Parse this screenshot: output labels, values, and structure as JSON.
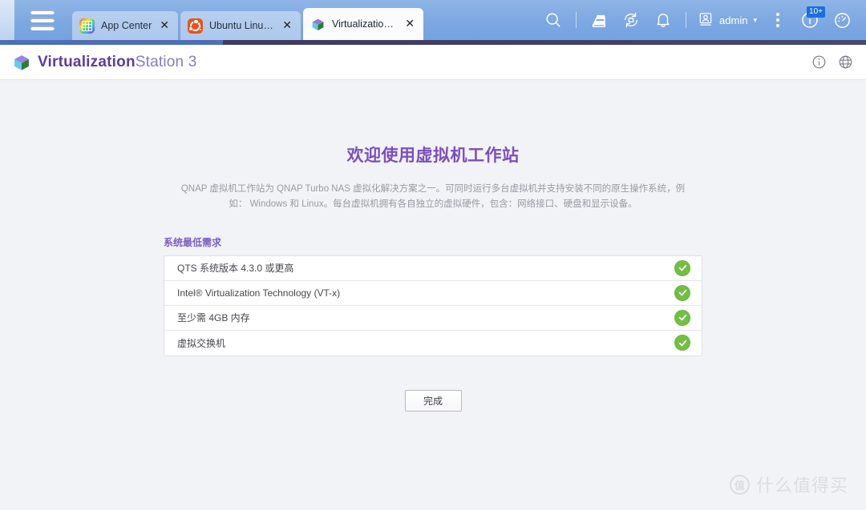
{
  "desktop": {
    "menu_icon": "hamburger-menu-icon",
    "tabs": [
      {
        "label": "App Center",
        "icon": "app-center-icon",
        "close": "✕",
        "active": false
      },
      {
        "label": "Ubuntu Linux ...",
        "icon": "ubuntu-icon",
        "close": "✕",
        "active": false
      },
      {
        "label": "Virtualization ...",
        "icon": "virtualization-cube-icon",
        "close": "✕",
        "active": true
      }
    ],
    "system_icons": [
      "search-icon",
      "background-tasks-icon",
      "sync-icon",
      "notification-bell-icon"
    ],
    "user": {
      "name": "admin",
      "caret": "▾",
      "icon": "user-avatar-icon"
    },
    "more_icon": "more-options-icon",
    "info_icon": "info-icon",
    "info_badge": "10+",
    "dashboard_icon": "dashboard-gauge-icon"
  },
  "app": {
    "title_bold": "Virtualization",
    "title_normal": "Station 3",
    "logo_icon": "virtualization-cube-icon",
    "header_icons": [
      "info-icon",
      "language-globe-icon"
    ]
  },
  "main": {
    "welcome_title": "欢迎使用虚拟机工作站",
    "description": "QNAP 虚拟机工作站为 QNAP Turbo NAS 虚拟化解决方案之一。可同时运行多台虚拟机并支持安装不同的原生操作系统，例如： Windows 和 Linux。每台虚拟机拥有各自独立的虚拟硬件，包含：网络接口、硬盘和显示设备。",
    "requirements_heading": "系统最低需求",
    "requirements": [
      {
        "label": "QTS 系统版本 4.3.0 或更高",
        "status": "ok"
      },
      {
        "label": "Intel® Virtualization Technology (VT-x)",
        "status": "ok"
      },
      {
        "label": "至少需 4GB 内存",
        "status": "ok"
      },
      {
        "label": "虚拟交换机",
        "status": "ok"
      }
    ],
    "finish_button": "完成"
  },
  "watermark": {
    "badge": "值",
    "text": "什么值得买"
  },
  "colors": {
    "accent_purple": "#7b4fbf",
    "title_bold_purple": "#5b3e9e",
    "check_green": "#72bf44",
    "topbar_blue": "#7da8e2",
    "badge_blue": "#1a6ee0"
  }
}
